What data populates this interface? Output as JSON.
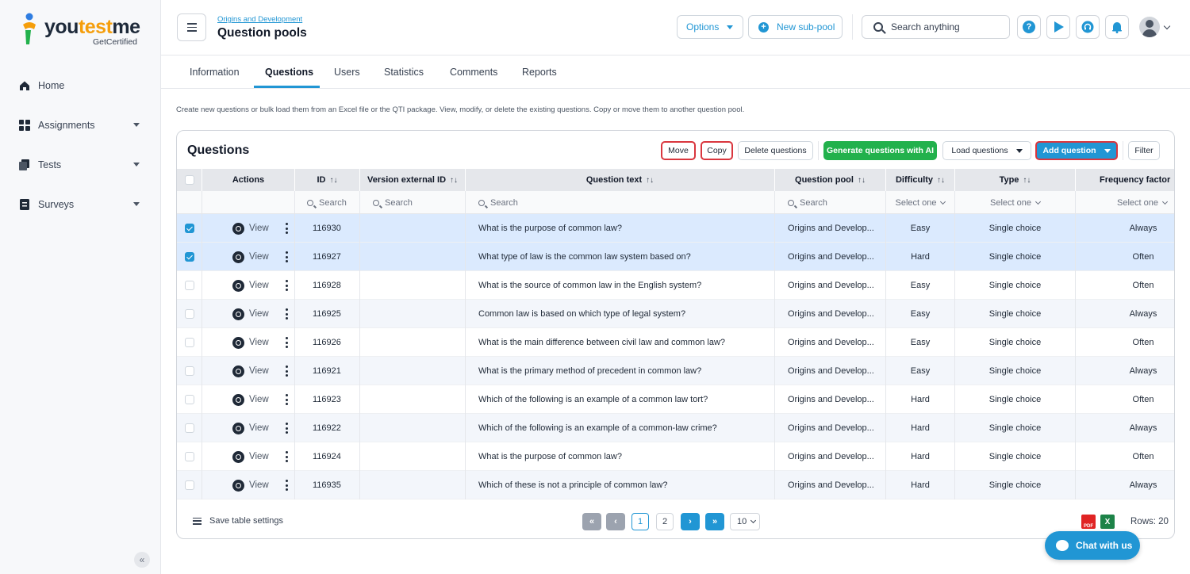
{
  "brand": {
    "name_a": "you",
    "name_b": "test",
    "name_c": "me",
    "sub": "GetCertified"
  },
  "sidebar": {
    "items": [
      {
        "label": "Home"
      },
      {
        "label": "Assignments"
      },
      {
        "label": "Tests"
      },
      {
        "label": "Surveys"
      }
    ],
    "collapse": "«"
  },
  "header": {
    "breadcrumb": "Origins and Development",
    "title": "Question pools",
    "options": "Options",
    "new_subpool": "New sub-pool",
    "search_placeholder": "Search anything",
    "help": "?"
  },
  "tabs": [
    "Information",
    "Questions",
    "Users",
    "Statistics",
    "Comments",
    "Reports"
  ],
  "description": "Create new questions or bulk load them from an Excel file or the QTI package. View, modify, or delete the existing questions. Copy or move them to another question pool.",
  "card": {
    "title": "Questions",
    "buttons": {
      "move": "Move",
      "copy": "Copy",
      "delete": "Delete questions",
      "generate": "Generate questions with AI",
      "load": "Load questions",
      "add": "Add question",
      "filter": "Filter"
    }
  },
  "table": {
    "columns": [
      "Actions",
      "ID",
      "Version external ID",
      "Question text",
      "Question pool",
      "Difficulty",
      "Type",
      "Frequency factor"
    ],
    "sort_glyph": "↑↓",
    "search": "Search",
    "select_one": "Select one",
    "view": "View",
    "rows": [
      {
        "id": "116930",
        "text": "What is the purpose of common law?",
        "pool": "Origins and Develop...",
        "difficulty": "Easy",
        "type": "Single choice",
        "freq": "Always"
      },
      {
        "id": "116927",
        "text": "What type of law is the common law system based on?",
        "pool": "Origins and Develop...",
        "difficulty": "Hard",
        "type": "Single choice",
        "freq": "Often"
      },
      {
        "id": "116928",
        "text": "What is the source of common law in the English system?",
        "pool": "Origins and Develop...",
        "difficulty": "Easy",
        "type": "Single choice",
        "freq": "Often"
      },
      {
        "id": "116925",
        "text": "Common law is based on which type of legal system?",
        "pool": "Origins and Develop...",
        "difficulty": "Easy",
        "type": "Single choice",
        "freq": "Always"
      },
      {
        "id": "116926",
        "text": "What is the main difference between civil law and common law?",
        "pool": "Origins and Develop...",
        "difficulty": "Easy",
        "type": "Single choice",
        "freq": "Often"
      },
      {
        "id": "116921",
        "text": "What is the primary method of precedent in common law?",
        "pool": "Origins and Develop...",
        "difficulty": "Easy",
        "type": "Single choice",
        "freq": "Always"
      },
      {
        "id": "116923",
        "text": "Which of the following is an example of a common law tort?",
        "pool": "Origins and Develop...",
        "difficulty": "Hard",
        "type": "Single choice",
        "freq": "Often"
      },
      {
        "id": "116922",
        "text": "Which of the following is an example of a common-law crime?",
        "pool": "Origins and Develop...",
        "difficulty": "Hard",
        "type": "Single choice",
        "freq": "Always"
      },
      {
        "id": "116924",
        "text": "What is the purpose of common law?",
        "pool": "Origins and Develop...",
        "difficulty": "Hard",
        "type": "Single choice",
        "freq": "Often"
      },
      {
        "id": "116935",
        "text": "Which of these is not a principle of common law?",
        "pool": "Origins and Develop...",
        "difficulty": "Hard",
        "type": "Single choice",
        "freq": "Always"
      }
    ]
  },
  "footer": {
    "save": "Save table settings",
    "first": "«",
    "prev": "‹",
    "page1": "1",
    "page2": "2",
    "next": "›",
    "last": "»",
    "page_size": "10",
    "rows": "Rows: 20"
  },
  "chat": "Chat with us",
  "colors": {
    "accent": "#2196d4",
    "green": "#22b14c",
    "highlight": "#d9363e"
  }
}
